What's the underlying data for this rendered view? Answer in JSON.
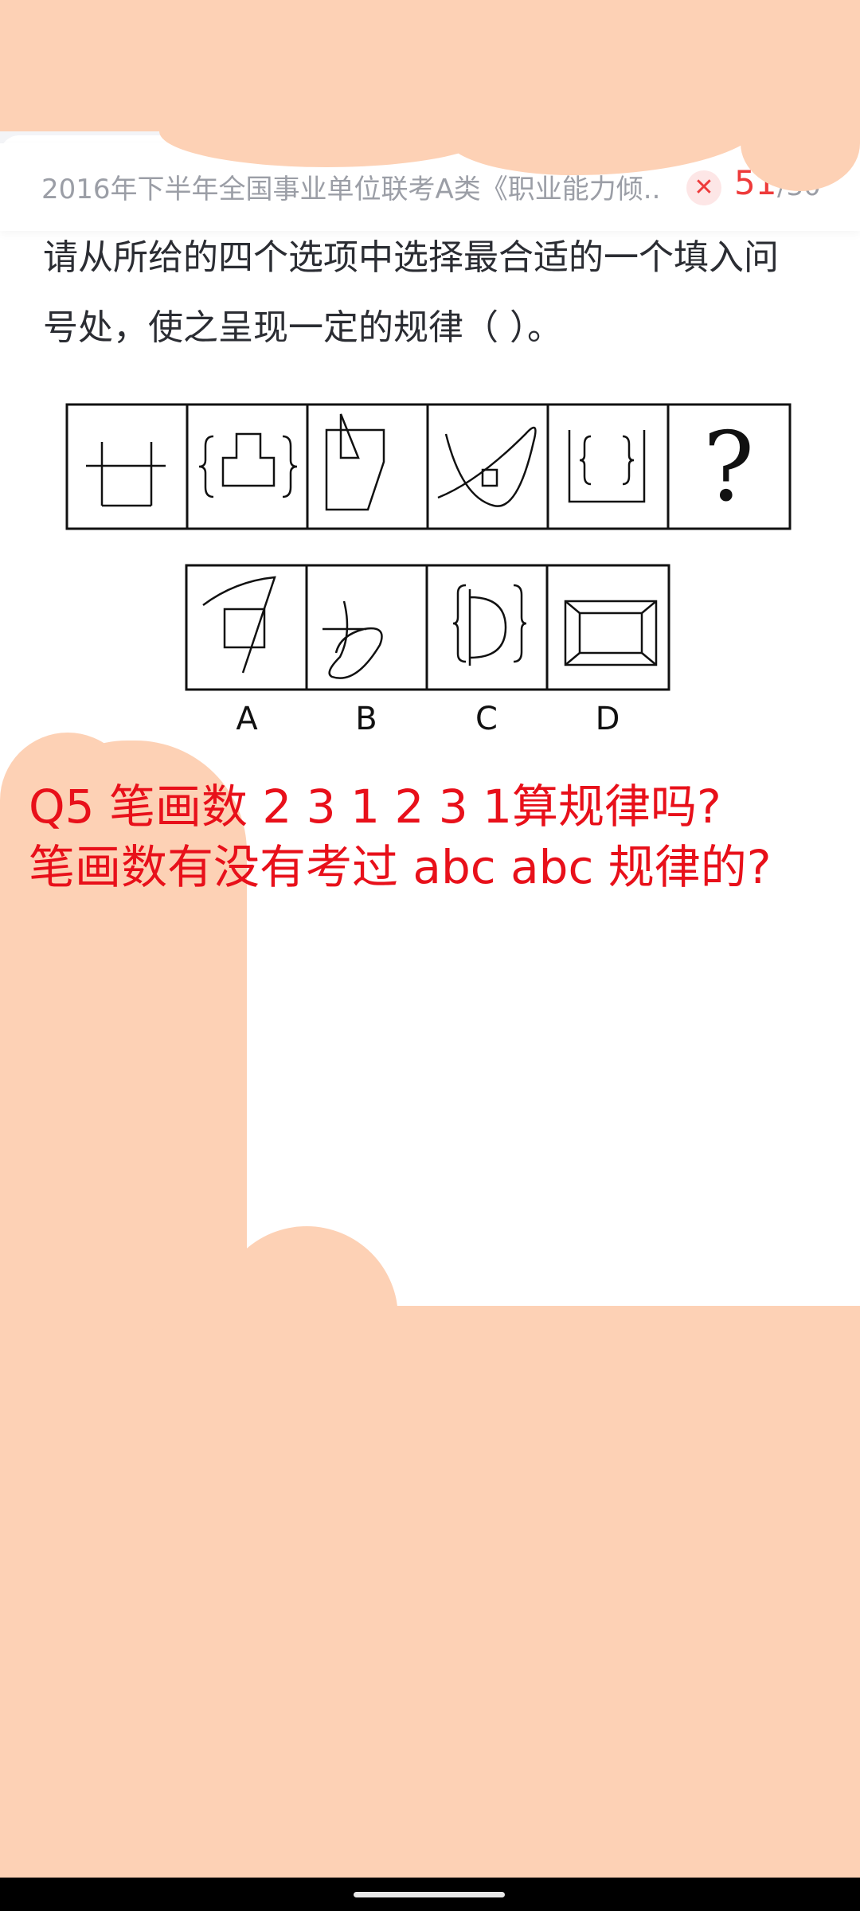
{
  "header": {
    "title": "2016年下半年全国事业单位联考A类《职业能力倾...",
    "status_icon": "wrong-x-icon",
    "current_index": "51",
    "total": "/30"
  },
  "question": {
    "line1": "请从所给的四个选项中选择最合适的一个填入问",
    "line2": "号处，使之呈现一定的规律（  ）。",
    "question_mark": "?",
    "options": [
      "A",
      "B",
      "C",
      "D"
    ]
  },
  "annotation": {
    "line1": "Q5 笔画数 2 3 1 2 3 1算规律吗?",
    "line2": "笔画数有没有考过 abc abc 规律的?"
  },
  "colors": {
    "accent_red": "#ee3b3b",
    "annotation_red": "#e8101a",
    "highlight_peach": "#fdd1b5"
  }
}
